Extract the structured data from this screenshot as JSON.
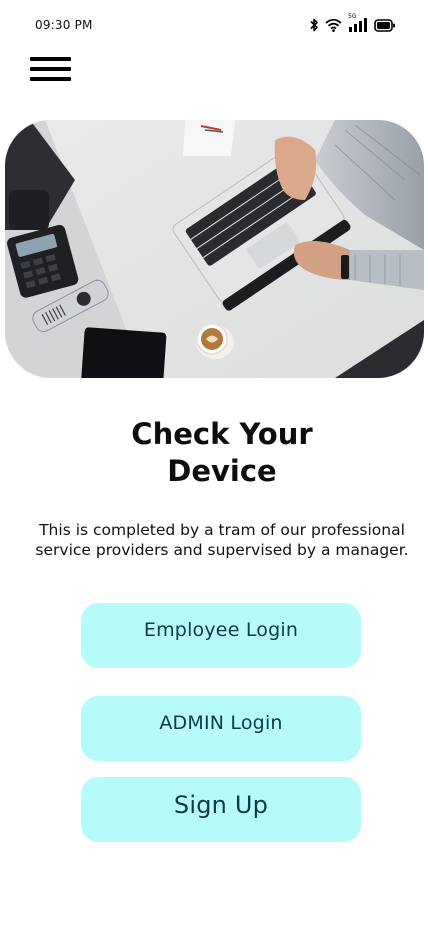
{
  "status_bar": {
    "time": "09:30 PM",
    "network_label": "5G",
    "icons": [
      "bluetooth-icon",
      "wifi-icon",
      "signal-icon",
      "battery-icon"
    ]
  },
  "header": {
    "menu_icon": "hamburger-menu-icon"
  },
  "hero": {
    "image": "office desk with laptop, desk phone, tablet and coffee cup"
  },
  "main": {
    "title_line1": "Check Your",
    "title_line2": "Device",
    "description": "This is completed by a tram of our professional service providers and supervised by a manager."
  },
  "buttons": {
    "employee_login": "Employee Login",
    "admin_login": "ADMIN Login",
    "sign_up": "Sign Up"
  },
  "colors": {
    "button_bg": "#b6fbfa",
    "button_text": "#0e3a4a",
    "background": "#ffffff"
  }
}
